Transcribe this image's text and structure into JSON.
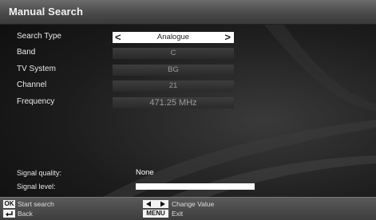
{
  "header": {
    "title": "Manual Search"
  },
  "rows": [
    {
      "label": "Search Type",
      "value": "Analogue"
    },
    {
      "label": "Band",
      "value": "C"
    },
    {
      "label": "TV System",
      "value": "BG"
    },
    {
      "label": "Channel",
      "value": "21"
    },
    {
      "label": "Frequency",
      "value": "471.25 MHz"
    }
  ],
  "signal": {
    "quality_label": "Signal quality:",
    "quality_value": "None",
    "level_label": "Signal level:",
    "level_fraction": 1.0
  },
  "footer": {
    "ok_key": "OK",
    "ok_hint": "Start search",
    "back_hint": "Back",
    "arrows_hint": "Change Value",
    "menu_key": "MENU",
    "menu_hint": "Exit"
  },
  "icons": {
    "left_arrow": "chevron-left-icon",
    "right_arrow": "chevron-right-icon",
    "back": "back-return-icon"
  }
}
